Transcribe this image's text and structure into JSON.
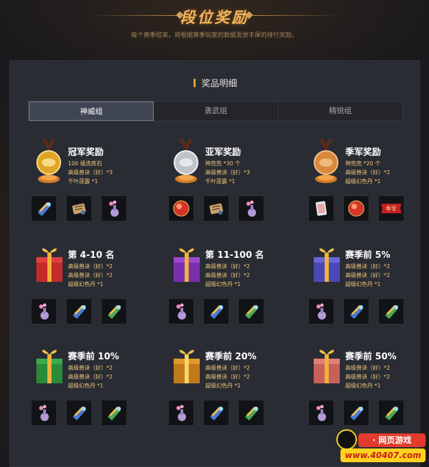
{
  "header": {
    "title": "段位奖励",
    "subtitle": "每个赛季结束，将根据赛季玩家的数据发放丰厚的排行奖励。"
  },
  "section": {
    "title": "奖品明细"
  },
  "tabs": [
    {
      "label": "神威组",
      "active": true
    },
    {
      "label": "勇武组",
      "active": false
    },
    {
      "label": "精锐组",
      "active": false
    }
  ],
  "rewards": [
    {
      "name": "冠军奖励",
      "lines": [
        "100 级洗炼石",
        "高级兽诀（好）*3",
        "千叶莲露 *1"
      ],
      "trophy": "gold-medal",
      "items": [
        "scroll-icon",
        "map-scroll-icon",
        "flower-vase-icon"
      ]
    },
    {
      "name": "亚军奖励",
      "lines": [
        "神兜兜 *30 个",
        "高级兽诀（好）*3",
        "千叶莲露 *1"
      ],
      "trophy": "silver-medal",
      "items": [
        "red-orb-icon",
        "map-scroll-icon",
        "flower-vase-icon"
      ]
    },
    {
      "name": "季军奖励",
      "lines": [
        "神兜兜 *20 个",
        "高级兽诀（好）*2",
        "超级幻色丹 *1"
      ],
      "trophy": "bronze-medal",
      "items": [
        "card-icon",
        "red-orb-icon",
        "title-badge-icon"
      ],
      "badge_text": "季军"
    },
    {
      "name": "第 4-10 名",
      "lines": [
        "高级兽诀（好）*2",
        "高级兽诀（好）*2",
        "超级幻色丹 *1"
      ],
      "trophy": "red-gift",
      "items": [
        "flower-vase-icon",
        "scroll-icon",
        "scroll-icon"
      ]
    },
    {
      "name": "第 11-100 名",
      "lines": [
        "高级兽诀（好）*2",
        "高级兽诀（好）*2",
        "超级幻色丹 *1"
      ],
      "trophy": "purple-gift",
      "items": [
        "flower-vase-icon",
        "scroll-icon",
        "scroll-icon"
      ]
    },
    {
      "name": "赛季前 5%",
      "lines": [
        "高级兽诀（好）*2",
        "高级兽诀（好）*2",
        "超级幻色丹 *1"
      ],
      "trophy": "blue-gift",
      "items": [
        "flower-vase-icon",
        "scroll-icon",
        "scroll-icon"
      ]
    },
    {
      "name": "赛季前 10%",
      "lines": [
        "高级兽诀（好）*2",
        "高级兽诀（好）*2",
        "超级幻色丹 *1"
      ],
      "trophy": "green-gift",
      "items": [
        "flower-vase-icon",
        "scroll-icon",
        "scroll-icon"
      ]
    },
    {
      "name": "赛季前 20%",
      "lines": [
        "高级兽诀（好）*2",
        "高级兽诀（好）*2",
        "超级幻色丹 *1"
      ],
      "trophy": "gold-gift",
      "items": [
        "flower-vase-icon",
        "scroll-icon",
        "scroll-icon"
      ]
    },
    {
      "name": "赛季前 50%",
      "lines": [
        "高级兽诀（好）*2",
        "高级兽诀（好）*2",
        "超级幻色丹 *1"
      ],
      "trophy": "pink-gift",
      "items": [
        "flower-vase-icon",
        "scroll-icon",
        "scroll-icon"
      ]
    }
  ],
  "watermark": {
    "top": "· 网页游戏",
    "bottom": "www.40407.com"
  },
  "colors": {
    "accent": "#f2b45a",
    "panel": "#2a2c33",
    "detail_text": "#f0c878"
  }
}
